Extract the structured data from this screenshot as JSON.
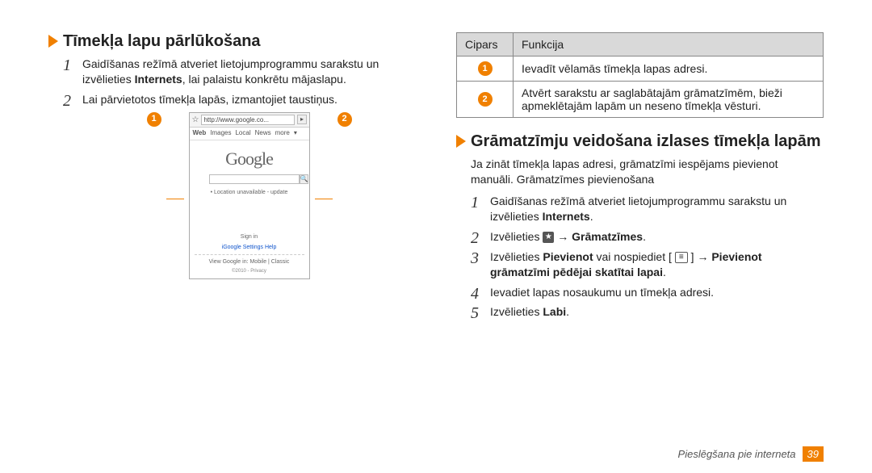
{
  "left": {
    "heading": "Tīmekļa lapu pārlūkošana",
    "steps": [
      {
        "pre": "Gaidīšanas režīmā atveriet lietojumprogrammu sarakstu un izvēlieties ",
        "bold": "Internets",
        "post": ", lai palaistu konkrētu mājaslapu."
      },
      {
        "pre": "Lai pārvietotos tīmekļa lapās, izmantojiet taustiņus.",
        "bold": "",
        "post": ""
      }
    ],
    "badge1": "1",
    "badge2": "2",
    "phone": {
      "url": "http://www.google.co...",
      "tabs": [
        "Web",
        "Images",
        "Local",
        "News",
        "more",
        "▾"
      ],
      "logo": "Google",
      "search_btn": "🔍",
      "loc": "• Location unavailable - update",
      "signin": "Sign in",
      "links": "iGoogle   Settings   Help",
      "mobile": "View Google in: Mobile | Classic",
      "copyright": "©2010 - Privacy"
    }
  },
  "right": {
    "table": {
      "headers": [
        "Cipars",
        "Funkcija"
      ],
      "rows": [
        {
          "num": "1",
          "desc": "Ievadīt vēlamās tīmekļa lapas adresi."
        },
        {
          "num": "2",
          "desc": "Atvērt sarakstu ar saglabātajām grāmatzīmēm, bieži apmeklētajām lapām un neseno tīmekļa vēsturi."
        }
      ]
    },
    "heading": "Grāmatzīmju veidošana izlases tīmekļa lapām",
    "intro": "Ja zināt tīmekļa lapas adresi, grāmatzīmi iespējams pievienot manuāli. Grāmatzīmes pievienošana",
    "steps": [
      {
        "parts": [
          {
            "t": "Gaidīšanas režīmā atveriet lietojumprogrammu sarakstu un izvēlieties "
          },
          {
            "t": "Internets",
            "b": true
          },
          {
            "t": "."
          }
        ]
      },
      {
        "parts": [
          {
            "t": "Izvēlieties "
          },
          {
            "star": true
          },
          {
            "t": " → "
          },
          {
            "t": "Grāmatzīmes",
            "b": true
          },
          {
            "t": "."
          }
        ]
      },
      {
        "parts": [
          {
            "t": "Izvēlieties "
          },
          {
            "t": "Pievienot",
            "b": true
          },
          {
            "t": " vai nospiediet [ "
          },
          {
            "kb": "≡"
          },
          {
            "t": " ] → "
          },
          {
            "t": "Pievienot grāmatzīmi pēdējai skatītai lapai",
            "b": true
          },
          {
            "t": "."
          }
        ]
      },
      {
        "parts": [
          {
            "t": "Ievadiet lapas nosaukumu un tīmekļa adresi."
          }
        ]
      },
      {
        "parts": [
          {
            "t": "Izvēlieties "
          },
          {
            "t": "Labi",
            "b": true
          },
          {
            "t": "."
          }
        ]
      }
    ]
  },
  "footer": {
    "section": "Pieslēgšana pie interneta",
    "page": "39"
  }
}
